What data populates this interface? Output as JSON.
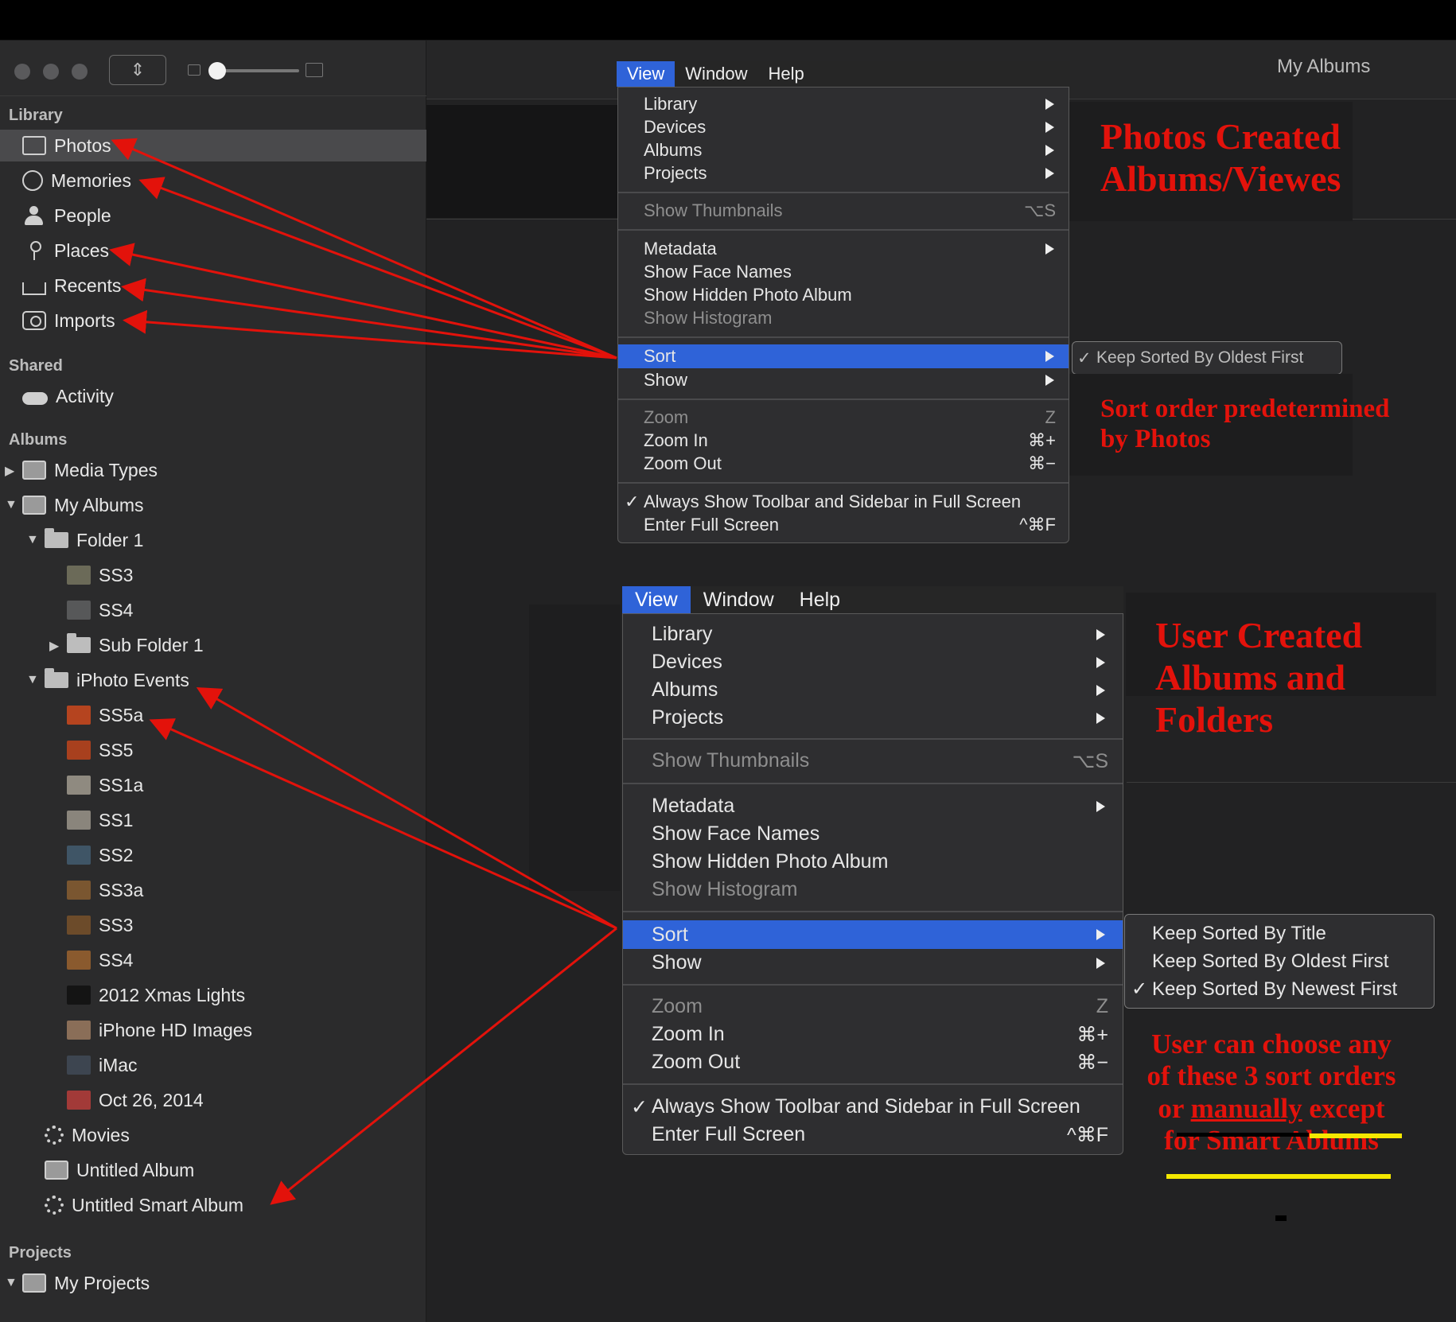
{
  "sidebar": {
    "library_header": "Library",
    "library_items": [
      {
        "label": "Photos"
      },
      {
        "label": "Memories"
      },
      {
        "label": "People"
      },
      {
        "label": "Places"
      },
      {
        "label": "Recents"
      },
      {
        "label": "Imports"
      }
    ],
    "shared_header": "Shared",
    "shared_items": [
      {
        "label": "Activity"
      }
    ],
    "albums_header": "Albums",
    "album_items": [
      {
        "label": "Media Types"
      },
      {
        "label": "My Albums"
      },
      {
        "label": "Folder 1"
      },
      {
        "label": "SS3"
      },
      {
        "label": "SS4"
      },
      {
        "label": "Sub Folder 1"
      },
      {
        "label": "iPhoto Events"
      },
      {
        "label": "SS5a"
      },
      {
        "label": "SS5"
      },
      {
        "label": "SS1a"
      },
      {
        "label": "SS1"
      },
      {
        "label": "SS2"
      },
      {
        "label": "SS3a"
      },
      {
        "label": "SS3"
      },
      {
        "label": "SS4"
      },
      {
        "label": "2012 Xmas Lights"
      },
      {
        "label": "iPhone HD Images"
      },
      {
        "label": "iMac"
      },
      {
        "label": "Oct 26, 2014"
      },
      {
        "label": "Movies"
      },
      {
        "label": "Untitled Album"
      },
      {
        "label": "Untitled Smart Album"
      }
    ],
    "projects_header": "Projects",
    "project_items": [
      {
        "label": "My Projects"
      }
    ]
  },
  "window_title_fragment": "My Albums",
  "menubar_top": {
    "items": [
      "View",
      "Window",
      "Help"
    ],
    "active": "View"
  },
  "menubar_bottom": {
    "items": [
      "View",
      "Window",
      "Help"
    ],
    "active": "View"
  },
  "view_menu": {
    "library": "Library",
    "devices": "Devices",
    "albums": "Albums",
    "projects": "Projects",
    "show_thumbnails": "Show Thumbnails",
    "show_thumbnails_shortcut": "⌥S",
    "metadata": "Metadata",
    "show_face_names": "Show Face Names",
    "show_hidden_album": "Show Hidden Photo Album",
    "show_histogram": "Show Histogram",
    "sort": "Sort",
    "show": "Show",
    "zoom": "Zoom",
    "zoom_shortcut": "Z",
    "zoom_in": "Zoom In",
    "zoom_in_shortcut": "⌘+",
    "zoom_out": "Zoom Out",
    "zoom_out_shortcut": "⌘−",
    "always_show_toolbar": "Always Show Toolbar and Sidebar in Full Screen",
    "enter_full_screen": "Enter Full Screen",
    "enter_full_screen_shortcut": "^⌘F",
    "checkmark": "✓"
  },
  "sort_submenu_top": {
    "items": [
      "Keep Sorted By Oldest First"
    ],
    "checked_index": 0
  },
  "sort_submenu_bottom": {
    "items": [
      "Keep Sorted By Title",
      "Keep Sorted By Oldest First",
      "Keep Sorted By Newest First"
    ],
    "checked_index": 2
  },
  "annotations": {
    "top_title_line1": "Photos Created",
    "top_title_line2": "Albums/Viewes",
    "top_note_line1": "Sort order predetermined",
    "top_note_line2": "by Photos",
    "bottom_title_line1": "User Created",
    "bottom_title_line2": "Albums and",
    "bottom_title_line3": "Folders",
    "bottom_note_line1": "User can choose any",
    "bottom_note_line2": "of these 3 sort orders",
    "bottom_note_line3_a": "or",
    "bottom_note_line3_b": "manually",
    "bottom_note_line3_c": "except",
    "bottom_note_line4": "for Smart Ablums"
  },
  "colors": {
    "annotation_red": "#e3120b",
    "menu_highlight": "#2f63d8",
    "highlighter_yellow": "#f4e800"
  }
}
